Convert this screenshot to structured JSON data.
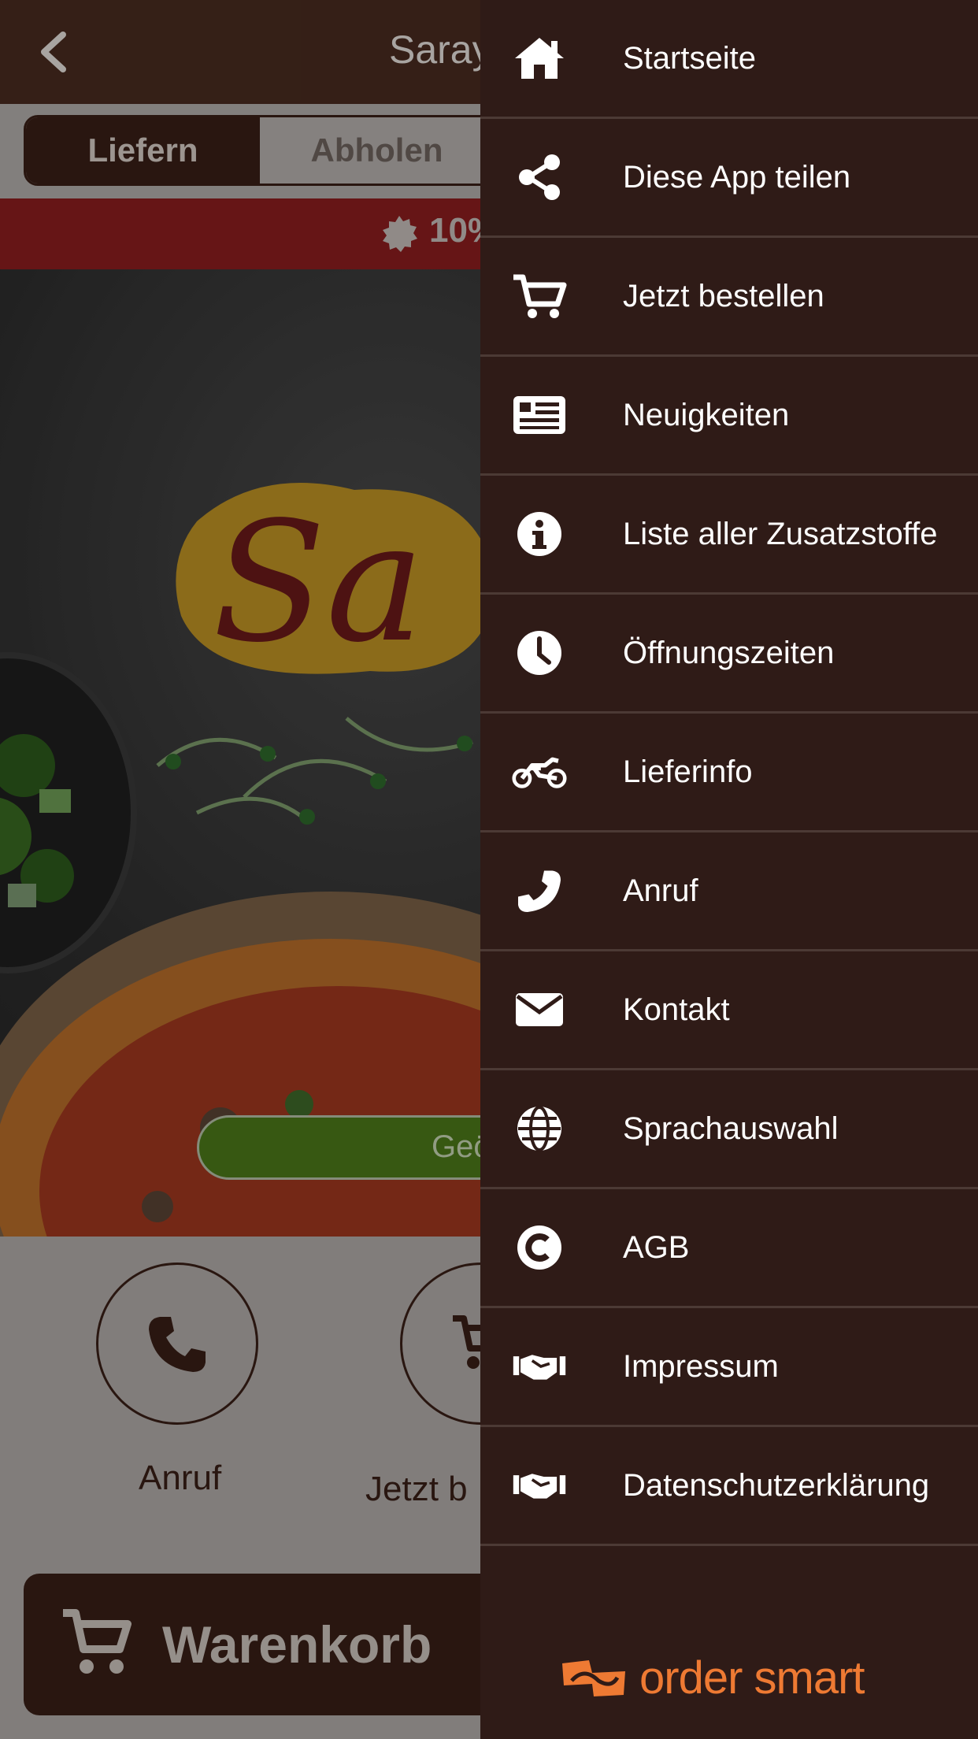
{
  "app": {
    "title": "Saray",
    "tabs": [
      {
        "label": "Liefern",
        "active": true
      },
      {
        "label": "Abholen",
        "active": false
      }
    ],
    "promo_text": "10%",
    "logo_text": "Sa",
    "geo_button_label": "Geö",
    "actions": [
      {
        "label": "Anruf",
        "icon": "phone-icon"
      },
      {
        "label": "Jetzt b",
        "icon": "cart-icon"
      }
    ],
    "cart_label": "Warenkorb",
    "colors": {
      "primary": "#4a2c20",
      "promo": "#8e1e1f",
      "geo_button": "#4d7a1a"
    }
  },
  "drawer": {
    "items": [
      {
        "label": "Startseite",
        "icon": "home-icon"
      },
      {
        "label": "Diese App teilen",
        "icon": "share-icon"
      },
      {
        "label": "Jetzt bestellen",
        "icon": "cart-icon"
      },
      {
        "label": "Neuigkeiten",
        "icon": "newspaper-icon"
      },
      {
        "label": "Liste aller Zusatzstoffe",
        "icon": "info-icon"
      },
      {
        "label": "Öffnungszeiten",
        "icon": "clock-icon"
      },
      {
        "label": "Lieferinfo",
        "icon": "motorcycle-icon"
      },
      {
        "label": "Anruf",
        "icon": "phone-icon"
      },
      {
        "label": "Kontakt",
        "icon": "envelope-icon"
      },
      {
        "label": "Sprachauswahl",
        "icon": "globe-icon"
      },
      {
        "label": "AGB",
        "icon": "copyright-icon"
      },
      {
        "label": "Impressum",
        "icon": "handshake-icon"
      },
      {
        "label": "Datenschutzerklärung",
        "icon": "handshake-icon"
      }
    ],
    "brand": "order smart",
    "colors": {
      "background": "#2f1b17",
      "brand": "#ee7a33"
    }
  }
}
